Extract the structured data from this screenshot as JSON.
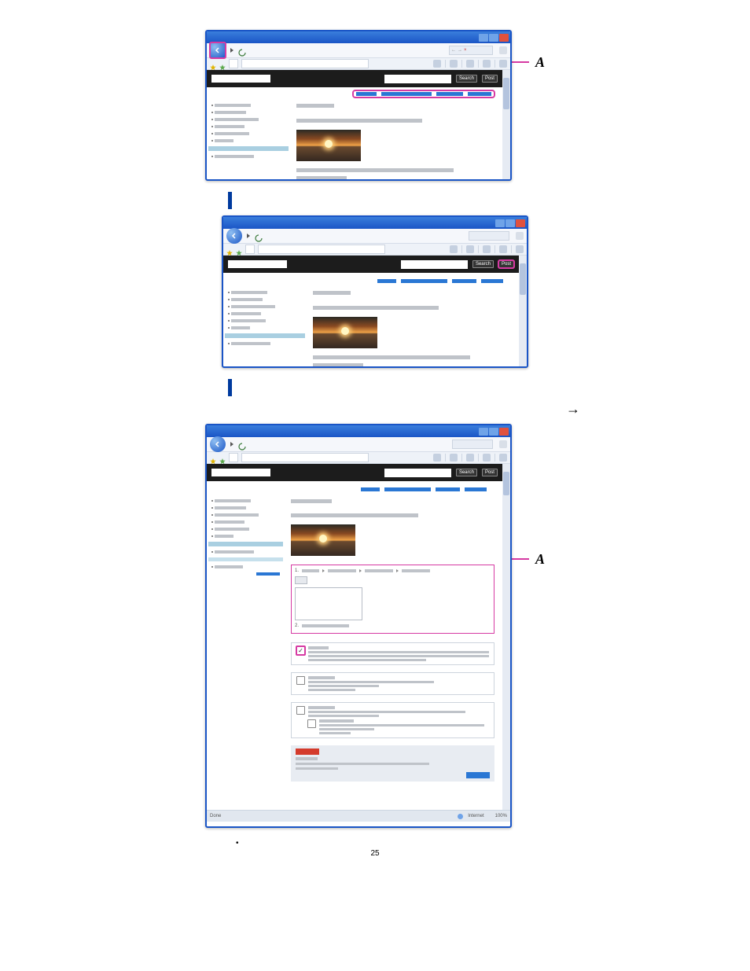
{
  "page_number": "25",
  "labels": {
    "A": "A"
  },
  "arrow": "→",
  "browser": {
    "buttons": {
      "search": "Search",
      "post": "Post"
    },
    "status": {
      "done": "Done",
      "zone": "Internet",
      "zoom": "100%"
    }
  },
  "screenshot1": {
    "highlight": "submenu-row",
    "callout": "A"
  },
  "screenshot2": {
    "highlight": "post-button"
  },
  "screenshot3": {
    "highlight": "post-area-and-checkbox",
    "callout": "A"
  }
}
